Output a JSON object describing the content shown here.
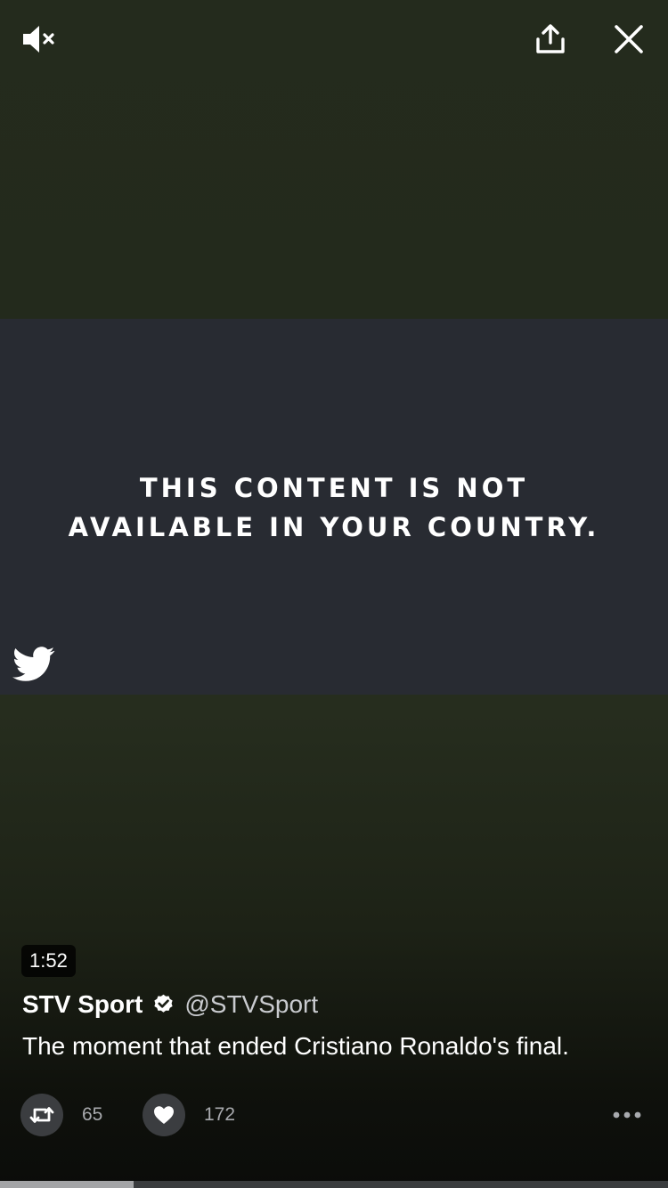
{
  "top_bar": {
    "mute_icon": "speaker-muted-icon",
    "share_icon": "share-upload-icon",
    "close_icon": "close-icon"
  },
  "video": {
    "message_line1": "THIS CONTENT IS NOT",
    "message_line2": "AVAILABLE IN YOUR COUNTRY.",
    "watermark_icon": "twitter-bird-icon",
    "duration": "1:52",
    "progress": 0.2
  },
  "tweet": {
    "author_name": "STV Sport",
    "verified_icon": "verified-badge-icon",
    "handle": "@STVSport",
    "text": "The moment that ended Cristiano Ronaldo's final."
  },
  "actions": {
    "retweet_icon": "retweet-icon",
    "retweet_count": "65",
    "like_icon": "heart-icon",
    "like_count": "172",
    "more_icon": "more-dots-icon"
  },
  "colors": {
    "background_top": "#242b1d",
    "video_block": "#282b32",
    "action_button": "#3b3d40",
    "count_text": "#a8aaae",
    "handle_text": "#c9cbcf"
  }
}
